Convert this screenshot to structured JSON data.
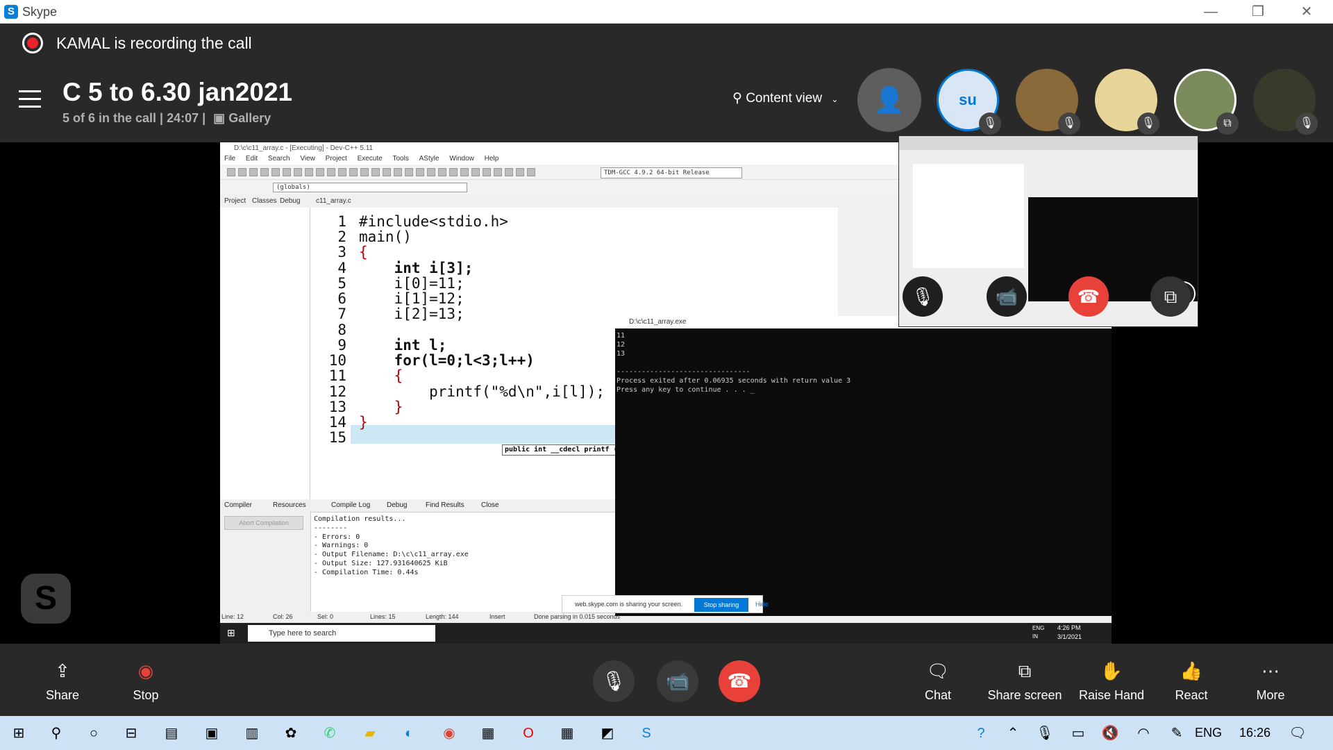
{
  "app": {
    "name": "Skype"
  },
  "window_controls": {
    "minimize": "—",
    "restore": "❐",
    "close": "✕"
  },
  "recording": {
    "text": "KAMAL is recording the call"
  },
  "call": {
    "title": "C 5 to 6.30 jan2021",
    "subtitle": "5 of 6 in the call | 24:07 |",
    "gallery": "Gallery",
    "content_view": "Content view"
  },
  "participants": [
    {
      "initials": "su",
      "color": "#d8e6f5"
    },
    {
      "initials": "",
      "color": "#8a6a3a"
    },
    {
      "initials": "",
      "color": "#e8d59a"
    },
    {
      "initials": "",
      "color": "#7a8a5a"
    },
    {
      "initials": "",
      "color": "#3a3a2a"
    }
  ],
  "devcpp": {
    "title": "D:\\c\\c11_array.c - [Executing] - Dev-C++ 5.11",
    "menu": [
      "File",
      "Edit",
      "Search",
      "View",
      "Project",
      "Execute",
      "Tools",
      "AStyle",
      "Window",
      "Help"
    ],
    "compiler": "TDM-GCC 4.9.2 64-bit Release",
    "globals": "(globals)",
    "tabs": {
      "project": "Project",
      "classes": "Classes",
      "debug": "Debug",
      "file": "c11_array.c"
    },
    "lines": [
      "#include<stdio.h>",
      "main()",
      "{",
      "    int i[3];",
      "    i[0]=11;",
      "    i[1]=12;",
      "    i[2]=13;",
      "",
      "    int l;",
      "    for(l=0;l<3;l++)",
      "    {",
      "        printf(\"%d\\n\",i[l]);",
      "    }",
      "}",
      ""
    ],
    "line_numbers": [
      "1",
      "2",
      "3",
      "4",
      "5",
      "6",
      "7",
      "8",
      "9",
      "10",
      "11",
      "12",
      "13",
      "14",
      "15"
    ],
    "tooltip": "public int __cdecl printf (const char * __restrict",
    "bottom_tabs": [
      "Compiler",
      "Resources",
      "Compile Log",
      "Debug",
      "Find Results",
      "Close"
    ],
    "abort": "Abort Compilation",
    "log": "Compilation results...\n--------\n- Errors: 0\n- Warnings: 0\n- Output Filename: D:\\c\\c11_array.exe\n- Output Size: 127.931640625 KiB\n- Compilation Time: 0.44s",
    "status": {
      "line": "Line:   12",
      "col": "Col:   26",
      "sel": "Sel:   0",
      "lines": "Lines:   15",
      "length": "Length:   144",
      "mode": "Insert",
      "msg": "Done parsing in 0.015 seconds"
    }
  },
  "console": {
    "title": "D:\\c\\c11_array.exe",
    "text": "11\n12\n13\n\n--------------------------------\nProcess exited after 0.06935 seconds with return value 3\nPress any key to continue . . . _"
  },
  "sharebar": {
    "text": "web.skype.com is sharing your screen.",
    "stop": "Stop sharing",
    "hide": "Hide"
  },
  "inner_taskbar": {
    "search": "Type here to search",
    "lang": "ENG\nIN",
    "time": "4:26 PM",
    "date": "3/1/2021"
  },
  "controls": {
    "share": "Share",
    "stop": "Stop",
    "chat": "Chat",
    "share_screen": "Share screen",
    "raise_hand": "Raise Hand",
    "react": "React",
    "more": "More"
  },
  "colors": {
    "hangup": "#e8413a",
    "accent": "#0078d4",
    "header": "#292929"
  },
  "taskbar": {
    "lang": "ENG",
    "time": "16:26"
  }
}
